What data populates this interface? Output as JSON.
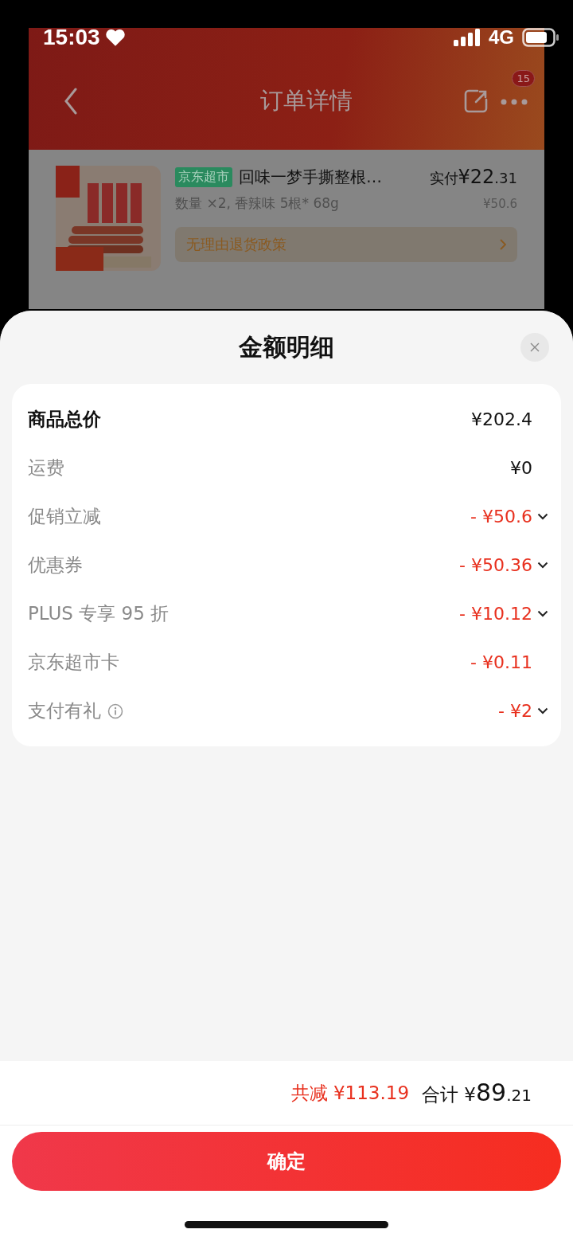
{
  "status_bar": {
    "time": "15:03",
    "network": "4G"
  },
  "header": {
    "title": "订单详情",
    "badge": "15"
  },
  "product": {
    "store_tag": "京东超市",
    "name": "回味一梦手撕整根…",
    "paid_label": "实付",
    "paid_int": "¥22",
    "paid_dec": ".31",
    "spec": "数量 ×2, 香辣味 5根* 68g",
    "original_price": "¥50.6",
    "policy": "无理由退货政策"
  },
  "sheet": {
    "title": "金额明细",
    "rows": [
      {
        "kind": "total",
        "label": "商品总价",
        "value": "¥202.4",
        "chevron": false,
        "info": false
      },
      {
        "kind": "plain",
        "label": "运费",
        "value": "¥0",
        "chevron": false,
        "info": false
      },
      {
        "kind": "discount",
        "label": "促销立减",
        "value": "- ¥50.6",
        "chevron": true,
        "info": false
      },
      {
        "kind": "discount",
        "label": "优惠券",
        "value": "- ¥50.36",
        "chevron": true,
        "info": false
      },
      {
        "kind": "discount",
        "label": "PLUS 专享 95 折",
        "value": "- ¥10.12",
        "chevron": true,
        "info": false
      },
      {
        "kind": "discount",
        "label": "京东超市卡",
        "value": "- ¥0.11",
        "chevron": false,
        "info": false
      },
      {
        "kind": "discount",
        "label": "支付有礼",
        "value": "- ¥2",
        "chevron": true,
        "info": true
      }
    ]
  },
  "summary": {
    "discount_label": "共减",
    "discount_value": "¥113.19",
    "total_label": "合计",
    "total_symbol": "¥",
    "total_int": "89",
    "total_dec": ".21"
  },
  "confirm_button": "确定"
}
